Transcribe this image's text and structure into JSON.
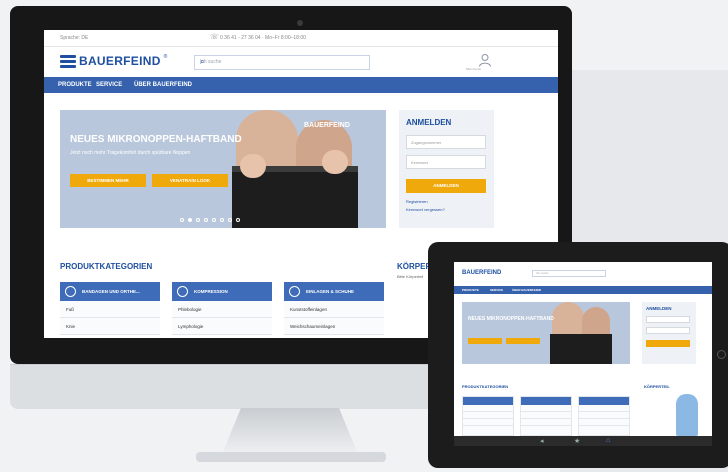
{
  "desktop": {
    "utility": {
      "language": "Sprache: DE",
      "phone": "0 36 41 - 27 36 04 · Mo–Fr 8:00–18:00"
    },
    "brand": "BAUERFEIND",
    "brand_reg": "®",
    "search": {
      "placeholder": "Ich suche"
    },
    "account": {
      "label": "Mein Konto"
    },
    "nav": [
      "PRODUKTE",
      "SERVICE",
      "ÜBER BAUERFEIND"
    ],
    "hero": {
      "title": "NEUES MIKRONOPPEN-HAFTBAND",
      "subtitle": "Jetzt noch mehr Tragekomfort durch spürbare Noppen",
      "button_primary": "BESTIMMEN MEHR",
      "button_secondary": "VENATRAIN LOOK",
      "logo": "BAUERFEIND",
      "slides": 8,
      "active_slide": 2
    },
    "login": {
      "title": "ANMELDEN",
      "username_placeholder": "Zugangsnummer",
      "password_placeholder": "Kennwort",
      "submit": "ANMELDEN",
      "register": "Registrieren",
      "forgot": "Kennwort vergessen?"
    },
    "categories_title": "PRODUKTKATEGORIEN",
    "categories": [
      {
        "title": "BANDAGEN UND ORTHE...",
        "items": [
          "Fuß",
          "Knie"
        ]
      },
      {
        "title": "KOMPRESSION",
        "items": [
          "Phlebologie",
          "Lymphologie"
        ]
      },
      {
        "title": "EINLAGEN & SCHUHE",
        "items": [
          "Kunststoffeinlagen",
          "Weichschaumeinlagen"
        ]
      }
    ],
    "body_map": {
      "title": "KÖRPERT",
      "subtitle": "Bitte Körperteil"
    }
  },
  "tablet": {
    "brand": "BAUERFEIND",
    "search_placeholder": "Ich suche",
    "nav": [
      "PRODUKTE",
      "SERVICE",
      "ÜBER BAUERFEIND"
    ],
    "hero_title": "NEUES MIKRONOPPEN-HAFTBAND",
    "login_title": "ANMELDEN",
    "categories_title": "PRODUKTKATEGORIEN",
    "body_map_title": "KÖRPERTEIL"
  },
  "colors": {
    "brand_blue": "#1e4fa0",
    "nav_blue": "#3561ad",
    "accent_orange": "#f0a90a"
  }
}
